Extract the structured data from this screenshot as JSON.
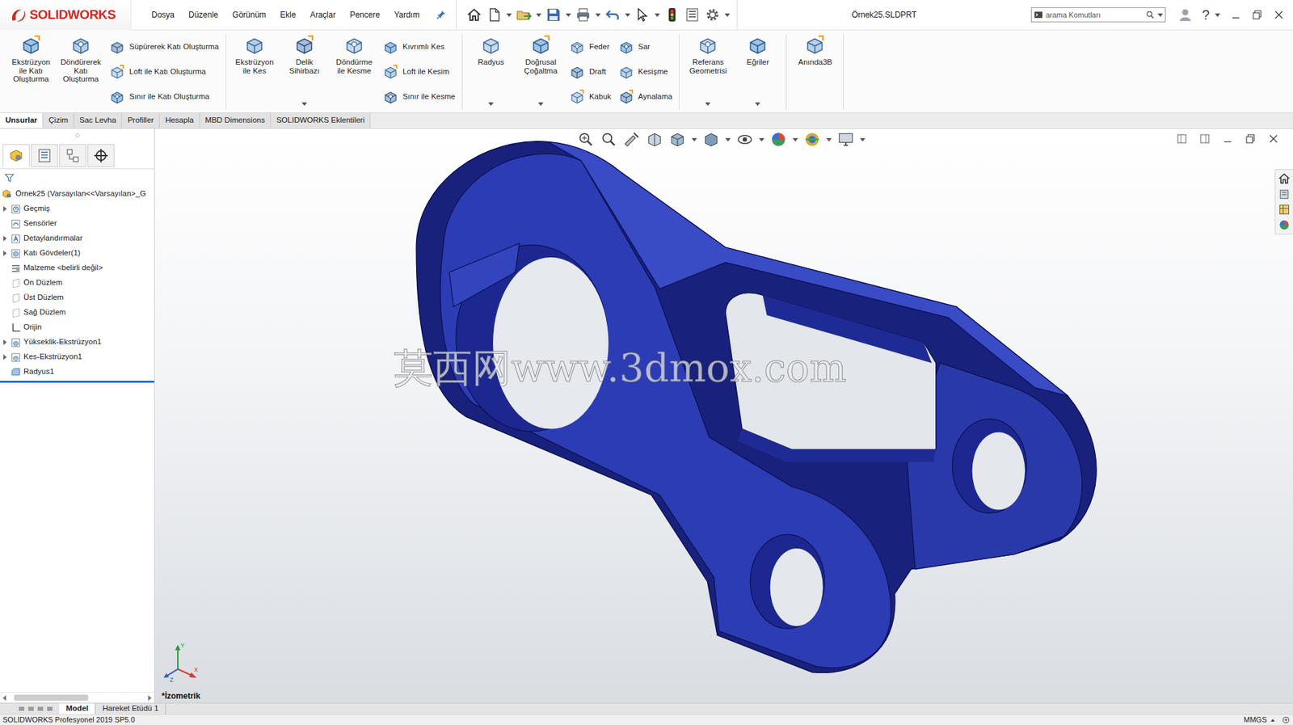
{
  "titlebar": {
    "logo": "SOLIDWORKS",
    "menu": [
      "Dosya",
      "Düzenle",
      "Görünüm",
      "Ekle",
      "Araçlar",
      "Pencere",
      "Yardım"
    ],
    "document_title": "Örnek25.SLDPRT",
    "search": {
      "placeholder": "arama Komutları"
    },
    "help": "?"
  },
  "ribbon": {
    "groups": [
      {
        "columns": [
          {
            "kind": "large",
            "label": "Ekstrüzyon ile Katı Oluşturma",
            "dropdown": false
          },
          {
            "kind": "large",
            "label": "Döndürerek Katı Oluşturma",
            "dropdown": false
          },
          {
            "kind": "stack",
            "items": [
              "Süpürerek Katı Oluşturma",
              "Loft ile Katı Oluşturma",
              "Sınır ile Katı Oluşturma"
            ]
          }
        ]
      },
      {
        "columns": [
          {
            "kind": "large",
            "label": "Ekstrüzyon ile Kes",
            "dropdown": false
          },
          {
            "kind": "large",
            "label": "Delik Sihirbazı",
            "dropdown": true
          },
          {
            "kind": "large",
            "label": "Döndürme ile Kesme",
            "dropdown": false
          },
          {
            "kind": "stack",
            "items": [
              "Kıvrımlı Kes",
              "Loft ile Kesim",
              "Sınır ile Kesme"
            ]
          }
        ]
      },
      {
        "columns": [
          {
            "kind": "large",
            "label": "Radyus",
            "dropdown": true
          },
          {
            "kind": "large",
            "label": "Doğrusal Çoğaltma",
            "dropdown": true
          },
          {
            "kind": "stack",
            "items": [
              "Feder",
              "Draft",
              "Kabuk"
            ]
          },
          {
            "kind": "stack",
            "items": [
              "Sar",
              "Kesişme",
              "Aynalama"
            ]
          }
        ]
      },
      {
        "columns": [
          {
            "kind": "large",
            "label": "Referans Geometrisi",
            "dropdown": true
          },
          {
            "kind": "large",
            "label": "Eğriler",
            "dropdown": true
          }
        ]
      },
      {
        "columns": [
          {
            "kind": "large",
            "label": "Anında3B",
            "dropdown": false
          }
        ]
      }
    ]
  },
  "tabs": [
    {
      "label": "Unsurlar",
      "selected": true
    },
    {
      "label": "Çizim",
      "selected": false
    },
    {
      "label": "Sac Levha",
      "selected": false
    },
    {
      "label": "Profiller",
      "selected": false
    },
    {
      "label": "Hesapla",
      "selected": false
    },
    {
      "label": "MBD Dimensions",
      "selected": false
    },
    {
      "label": "SOLIDWORKS Eklentileri",
      "selected": false
    }
  ],
  "feature_tree": {
    "root": "Örnek25 (Varsayılan<<Varsayılan>_G",
    "items": [
      {
        "label": "Geçmiş",
        "expandable": true
      },
      {
        "label": "Sensörler",
        "expandable": false
      },
      {
        "label": "Detaylandırmalar",
        "expandable": true
      },
      {
        "label": "Katı Gövdeler(1)",
        "expandable": true
      },
      {
        "label": "Malzeme <belirli değil>",
        "expandable": false
      },
      {
        "label": "Ön Düzlem",
        "expandable": false
      },
      {
        "label": "Üst Düzlem",
        "expandable": false
      },
      {
        "label": "Sağ Düzlem",
        "expandable": false
      },
      {
        "label": "Orijin",
        "expandable": false
      },
      {
        "label": "Yükseklik-Ekstrüzyon1",
        "expandable": true
      },
      {
        "label": "Kes-Ekstrüzyon1",
        "expandable": true
      },
      {
        "label": "Radyus1",
        "expandable": false
      }
    ]
  },
  "viewport": {
    "view_label": "*İzometrik",
    "watermark": "莫西网www.3dmox.com",
    "triad": {
      "y": "Y",
      "x": "X",
      "z": "Z"
    }
  },
  "bottom_tabs": [
    {
      "label": "Model",
      "selected": true
    },
    {
      "label": "Hareket Etüdü 1",
      "selected": false
    }
  ],
  "status_bar": {
    "product": "SOLIDWORKS Profesyonel 2019 SP5.0",
    "units": "MMGS"
  }
}
